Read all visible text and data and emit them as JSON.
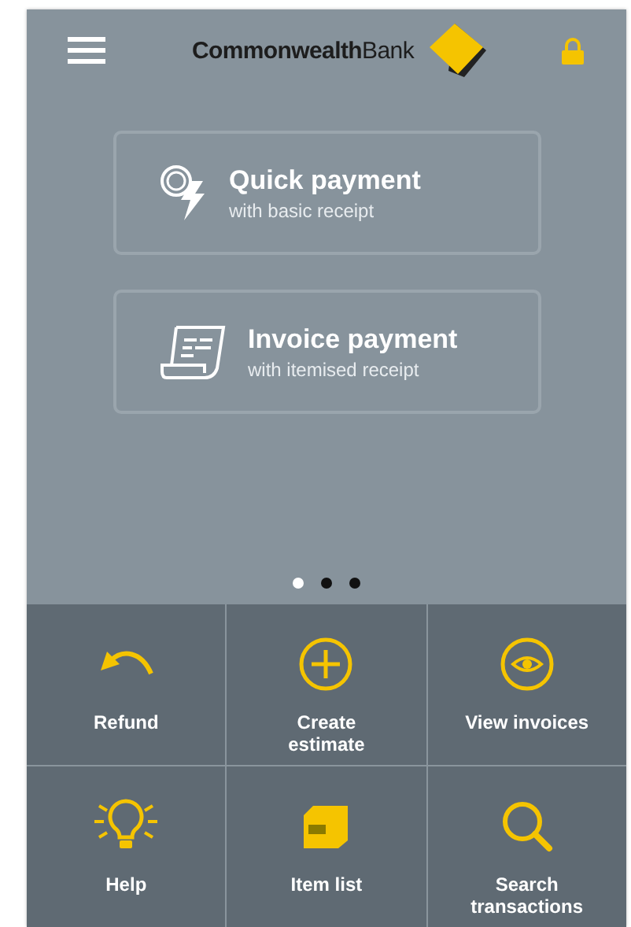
{
  "header": {
    "brand": "**Commonwealth**Bank"
  },
  "payment_options": [
    {
      "kind": "quick",
      "title": "Quick payment",
      "subtitle": "with basic receipt"
    },
    {
      "kind": "invoice",
      "title": "Invoice payment",
      "subtitle": "with itemised receipt"
    }
  ],
  "page_dots": [
    {
      "selected": true
    },
    {
      "selected": false
    },
    {
      "selected": false
    }
  ],
  "actions": [
    {
      "kind": "refund",
      "label": "Refund"
    },
    {
      "kind": "create",
      "label": "Create estimate"
    },
    {
      "kind": "view",
      "label": "View invoices"
    },
    {
      "kind": "help",
      "label": "Help"
    },
    {
      "kind": "items",
      "label": "Item list"
    },
    {
      "kind": "search",
      "label": "Search transactions"
    }
  ]
}
